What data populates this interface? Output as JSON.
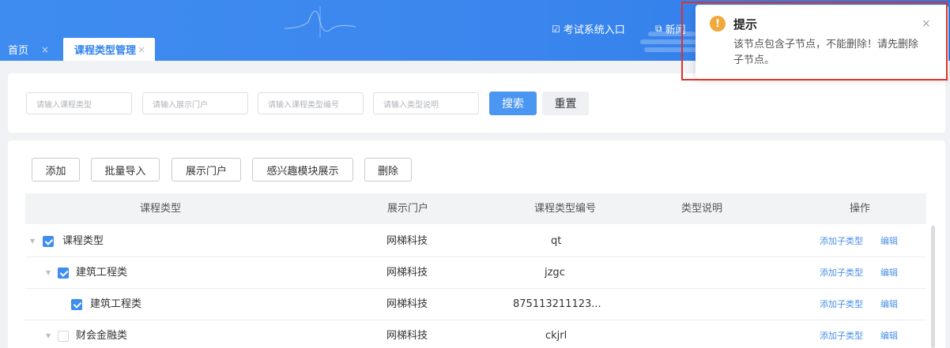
{
  "header": {
    "links": [
      {
        "icon": "edit-icon",
        "label": "考试系统入口"
      },
      {
        "icon": "window-icon",
        "label": "新闻"
      }
    ]
  },
  "tabs": [
    {
      "label": "首页",
      "close": "×"
    },
    {
      "label": "课程类型管理",
      "close": "×"
    }
  ],
  "search": {
    "placeholders": [
      "请输入课程类型",
      "请输入展示门户",
      "请输入课程类型编号",
      "请输入类型说明"
    ],
    "search_label": "搜索",
    "reset_label": "重置"
  },
  "toolbar": {
    "buttons": [
      "添加",
      "批量导入",
      "展示门户",
      "感兴趣模块展示",
      "删除"
    ]
  },
  "table": {
    "columns": [
      "课程类型",
      "展示门户",
      "课程类型编号",
      "类型说明",
      "操作"
    ],
    "rows": [
      {
        "name": "课程类型",
        "portal": "网梯科技",
        "code": "qt",
        "desc": "",
        "checked": true,
        "expandable": true,
        "level": 0
      },
      {
        "name": "建筑工程类",
        "portal": "网梯科技",
        "code": "jzgc",
        "desc": "",
        "checked": true,
        "expandable": true,
        "level": 1
      },
      {
        "name": "建筑工程类",
        "portal": "网梯科技",
        "code": "875113211123...",
        "desc": "",
        "checked": true,
        "expandable": false,
        "level": 2
      },
      {
        "name": "财会金融类",
        "portal": "网梯科技",
        "code": "ckjrl",
        "desc": "",
        "checked": false,
        "expandable": true,
        "level": 1
      }
    ],
    "actions": {
      "add_child": "添加子类型",
      "edit": "编辑"
    }
  },
  "notification": {
    "type": "warning",
    "icon": "!",
    "title": "提示",
    "message": "该节点包含子节点，不能删除！请先删除子节点。",
    "close": "×",
    "accent_color": "#f2a93b",
    "highlight_color": "#e0322b"
  },
  "colors": {
    "header": "#3a86ee",
    "primary": "#4b96f0",
    "link": "#4a90e8"
  }
}
